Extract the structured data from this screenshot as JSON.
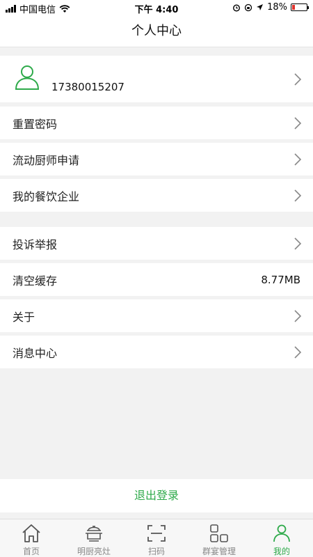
{
  "status_bar": {
    "carrier": "中国电信",
    "time": "下午 4:40",
    "battery": "18%"
  },
  "header": {
    "title": "个人中心"
  },
  "profile": {
    "phone": "17380015207"
  },
  "menu_group_1": [
    {
      "label": "重置密码"
    },
    {
      "label": "流动厨师申请"
    },
    {
      "label": "我的餐饮企业"
    }
  ],
  "menu_group_2": [
    {
      "label": "投诉举报"
    },
    {
      "label": "清空缓存",
      "value": "8.77MB"
    },
    {
      "label": "关于"
    },
    {
      "label": "消息中心"
    }
  ],
  "logout_label": "退出登录",
  "tabbar": [
    {
      "label": "首页",
      "icon": "home-icon"
    },
    {
      "label": "明厨亮灶",
      "icon": "pot-icon"
    },
    {
      "label": "扫码",
      "icon": "scan-icon"
    },
    {
      "label": "群宴管理",
      "icon": "grid-icon"
    },
    {
      "label": "我的",
      "icon": "person-icon"
    }
  ],
  "colors": {
    "accent": "#2eaa4a",
    "background": "#f2f2f2"
  }
}
